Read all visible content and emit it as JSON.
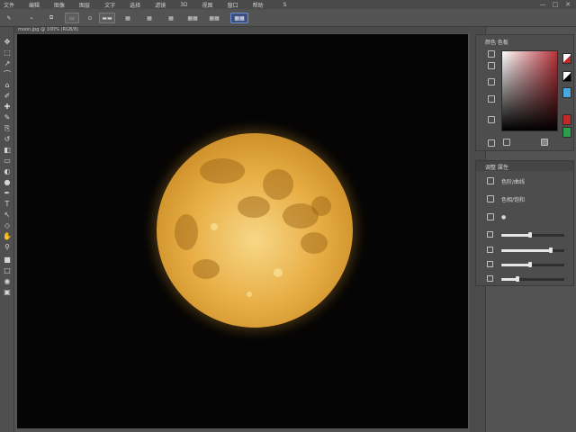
{
  "menu": {
    "items": [
      "文件",
      "编辑",
      "图像",
      "图层",
      "文字",
      "选择",
      "滤镜",
      "3D",
      "视图",
      "窗口",
      "帮助"
    ],
    "search_glyph": "S"
  },
  "window_controls": {
    "minimize": "—",
    "maximize": "□",
    "close": "✕"
  },
  "options_bar": {
    "tool_glyph": "✎",
    "items": [
      "⌁",
      "⧉",
      "▭",
      "⊙",
      "▬▬",
      "▦",
      "▦",
      "▦",
      "▦▦",
      "▦▦",
      "▦▦▦"
    ],
    "active_item": "▦▦"
  },
  "document": {
    "tab_label": "moon.jpg @ 100% (RGB/8)"
  },
  "toolbar": {
    "icons": [
      "move-icon",
      "marquee-icon",
      "lasso-icon",
      "quick-select-icon",
      "crop-icon",
      "eyedropper-icon",
      "healing-icon",
      "brush-icon",
      "clone-stamp-icon",
      "history-brush-icon",
      "eraser-icon",
      "gradient-icon",
      "blur-icon",
      "dodge-icon",
      "pen-icon",
      "type-icon",
      "path-select-icon",
      "shape-icon",
      "hand-icon",
      "zoom-icon",
      "foreground-color-icon",
      "background-color-icon",
      "quick-mask-icon",
      "screen-mode-icon"
    ],
    "glyphs": [
      "✥",
      "⬚",
      "↗",
      "⌒",
      "⌂",
      "✐",
      "✚",
      "✎",
      "⎘",
      "↺",
      "◧",
      "▭",
      "◐",
      "●",
      "✒",
      "T",
      "↖",
      "◇",
      "✋",
      "⚲",
      "■",
      "□",
      "◉",
      "▣"
    ]
  },
  "color_panel": {
    "title": "颜色 色板"
  },
  "adjustments_panel": {
    "title": "调整 属性",
    "rows": [
      {
        "label": "色阶/曲线"
      },
      {
        "label": "色相/饱和"
      }
    ],
    "sliders": [
      {
        "value": 0.45
      },
      {
        "value": 0.78
      },
      {
        "value": 0.45
      },
      {
        "value": 0.25
      }
    ]
  },
  "colors": {
    "accent_active": "#3d4f7a",
    "swatch_red": "#c0282a",
    "swatch_blue": "#4aa8e0",
    "swatch_green": "#2a9e4a"
  }
}
